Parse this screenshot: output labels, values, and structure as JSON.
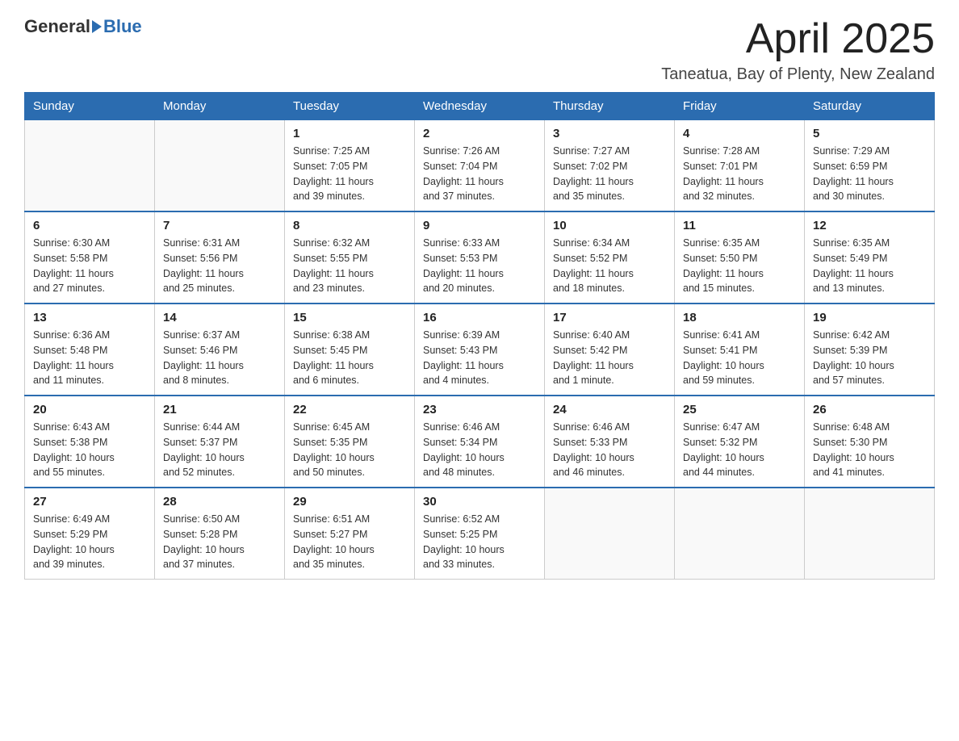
{
  "logo": {
    "general": "General",
    "blue": "Blue"
  },
  "title": "April 2025",
  "location": "Taneatua, Bay of Plenty, New Zealand",
  "days_header": [
    "Sunday",
    "Monday",
    "Tuesday",
    "Wednesday",
    "Thursday",
    "Friday",
    "Saturday"
  ],
  "weeks": [
    [
      {
        "day": "",
        "info": ""
      },
      {
        "day": "",
        "info": ""
      },
      {
        "day": "1",
        "info": "Sunrise: 7:25 AM\nSunset: 7:05 PM\nDaylight: 11 hours\nand 39 minutes."
      },
      {
        "day": "2",
        "info": "Sunrise: 7:26 AM\nSunset: 7:04 PM\nDaylight: 11 hours\nand 37 minutes."
      },
      {
        "day": "3",
        "info": "Sunrise: 7:27 AM\nSunset: 7:02 PM\nDaylight: 11 hours\nand 35 minutes."
      },
      {
        "day": "4",
        "info": "Sunrise: 7:28 AM\nSunset: 7:01 PM\nDaylight: 11 hours\nand 32 minutes."
      },
      {
        "day": "5",
        "info": "Sunrise: 7:29 AM\nSunset: 6:59 PM\nDaylight: 11 hours\nand 30 minutes."
      }
    ],
    [
      {
        "day": "6",
        "info": "Sunrise: 6:30 AM\nSunset: 5:58 PM\nDaylight: 11 hours\nand 27 minutes."
      },
      {
        "day": "7",
        "info": "Sunrise: 6:31 AM\nSunset: 5:56 PM\nDaylight: 11 hours\nand 25 minutes."
      },
      {
        "day": "8",
        "info": "Sunrise: 6:32 AM\nSunset: 5:55 PM\nDaylight: 11 hours\nand 23 minutes."
      },
      {
        "day": "9",
        "info": "Sunrise: 6:33 AM\nSunset: 5:53 PM\nDaylight: 11 hours\nand 20 minutes."
      },
      {
        "day": "10",
        "info": "Sunrise: 6:34 AM\nSunset: 5:52 PM\nDaylight: 11 hours\nand 18 minutes."
      },
      {
        "day": "11",
        "info": "Sunrise: 6:35 AM\nSunset: 5:50 PM\nDaylight: 11 hours\nand 15 minutes."
      },
      {
        "day": "12",
        "info": "Sunrise: 6:35 AM\nSunset: 5:49 PM\nDaylight: 11 hours\nand 13 minutes."
      }
    ],
    [
      {
        "day": "13",
        "info": "Sunrise: 6:36 AM\nSunset: 5:48 PM\nDaylight: 11 hours\nand 11 minutes."
      },
      {
        "day": "14",
        "info": "Sunrise: 6:37 AM\nSunset: 5:46 PM\nDaylight: 11 hours\nand 8 minutes."
      },
      {
        "day": "15",
        "info": "Sunrise: 6:38 AM\nSunset: 5:45 PM\nDaylight: 11 hours\nand 6 minutes."
      },
      {
        "day": "16",
        "info": "Sunrise: 6:39 AM\nSunset: 5:43 PM\nDaylight: 11 hours\nand 4 minutes."
      },
      {
        "day": "17",
        "info": "Sunrise: 6:40 AM\nSunset: 5:42 PM\nDaylight: 11 hours\nand 1 minute."
      },
      {
        "day": "18",
        "info": "Sunrise: 6:41 AM\nSunset: 5:41 PM\nDaylight: 10 hours\nand 59 minutes."
      },
      {
        "day": "19",
        "info": "Sunrise: 6:42 AM\nSunset: 5:39 PM\nDaylight: 10 hours\nand 57 minutes."
      }
    ],
    [
      {
        "day": "20",
        "info": "Sunrise: 6:43 AM\nSunset: 5:38 PM\nDaylight: 10 hours\nand 55 minutes."
      },
      {
        "day": "21",
        "info": "Sunrise: 6:44 AM\nSunset: 5:37 PM\nDaylight: 10 hours\nand 52 minutes."
      },
      {
        "day": "22",
        "info": "Sunrise: 6:45 AM\nSunset: 5:35 PM\nDaylight: 10 hours\nand 50 minutes."
      },
      {
        "day": "23",
        "info": "Sunrise: 6:46 AM\nSunset: 5:34 PM\nDaylight: 10 hours\nand 48 minutes."
      },
      {
        "day": "24",
        "info": "Sunrise: 6:46 AM\nSunset: 5:33 PM\nDaylight: 10 hours\nand 46 minutes."
      },
      {
        "day": "25",
        "info": "Sunrise: 6:47 AM\nSunset: 5:32 PM\nDaylight: 10 hours\nand 44 minutes."
      },
      {
        "day": "26",
        "info": "Sunrise: 6:48 AM\nSunset: 5:30 PM\nDaylight: 10 hours\nand 41 minutes."
      }
    ],
    [
      {
        "day": "27",
        "info": "Sunrise: 6:49 AM\nSunset: 5:29 PM\nDaylight: 10 hours\nand 39 minutes."
      },
      {
        "day": "28",
        "info": "Sunrise: 6:50 AM\nSunset: 5:28 PM\nDaylight: 10 hours\nand 37 minutes."
      },
      {
        "day": "29",
        "info": "Sunrise: 6:51 AM\nSunset: 5:27 PM\nDaylight: 10 hours\nand 35 minutes."
      },
      {
        "day": "30",
        "info": "Sunrise: 6:52 AM\nSunset: 5:25 PM\nDaylight: 10 hours\nand 33 minutes."
      },
      {
        "day": "",
        "info": ""
      },
      {
        "day": "",
        "info": ""
      },
      {
        "day": "",
        "info": ""
      }
    ]
  ]
}
